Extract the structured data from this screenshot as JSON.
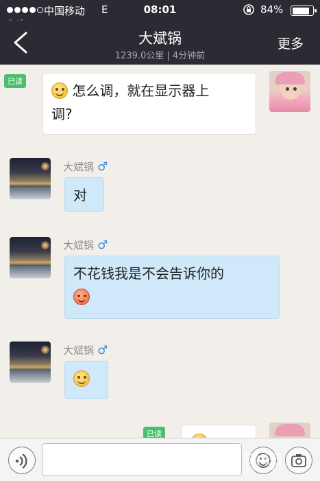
{
  "status_bar": {
    "carrier": "中国移动",
    "network": "E",
    "time": "08:01",
    "battery_percent": "84%",
    "battery_level": 0.84
  },
  "header": {
    "title": "大斌锅",
    "subtitle": "1239.0公里 | 4分钟前",
    "more_label": "更多"
  },
  "messages": [
    {
      "direction": "out",
      "read_label": "已读",
      "text_line1": "怎么调，就在显示器上",
      "text_line2": "调?",
      "leading_emoji": "smile-emoji"
    },
    {
      "direction": "in",
      "sender": "大斌锅",
      "gender_symbol": "♂",
      "text": "对"
    },
    {
      "direction": "in",
      "sender": "大斌锅",
      "gender_symbol": "♂",
      "text": "不花钱我是不会告诉你的",
      "trailing_emoji": "blush-emoji"
    },
    {
      "direction": "in",
      "sender": "大斌锅",
      "gender_symbol": "♂",
      "emoji_only": "smile-emoji"
    },
    {
      "direction": "out",
      "read_label": "已读",
      "partial": true
    }
  ],
  "watermark": {
    "top_left": "铁甲",
    "bottom_right": "铁甲"
  },
  "colors": {
    "header_bg": "#2b2c33",
    "incoming_bubble": "#cfe9fb",
    "outgoing_bubble": "#ffffff",
    "read_tag": "#4bbf6b",
    "male_symbol": "#3b8ed8",
    "chat_bg": "#f2efea"
  },
  "input": {
    "value": "",
    "placeholder": ""
  }
}
